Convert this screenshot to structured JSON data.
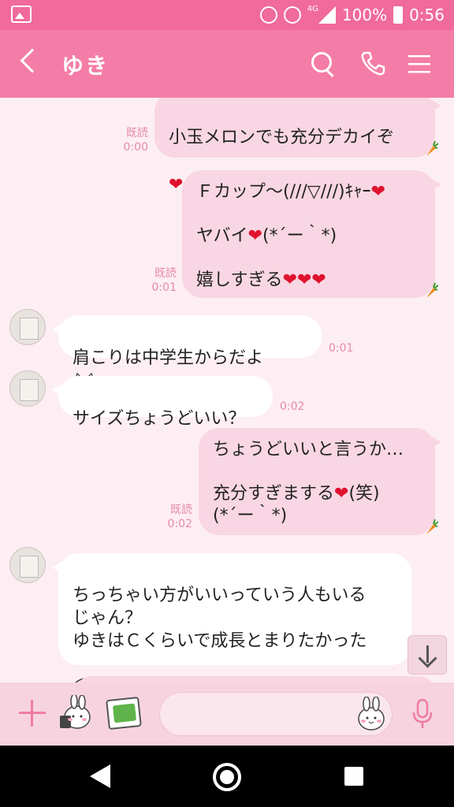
{
  "status_bar": {
    "network": "4G",
    "battery": "100%",
    "time": "0:56"
  },
  "header": {
    "title": "ゆき"
  },
  "messages": [
    {
      "id": 1,
      "dir": "out",
      "text": "小玉メロンでも充分デカイぞ",
      "hearts": "❤",
      "read": "既読",
      "time": "0:00"
    },
    {
      "id": 2,
      "dir": "out",
      "text_lines": [
        "Ｆカップ〜(///▽///)ｷｬｰ",
        "",
        "ヤバイ",
        "",
        "嬉しすぎる"
      ],
      "heart1": "❤",
      "heart2": "❤",
      "heart3": "❤❤❤",
      "kaomoji1": "(*´ー｀*)",
      "read": "既読",
      "time": "0:01"
    },
    {
      "id": 3,
      "dir": "in",
      "text": "肩こりは中学生からだよ",
      "time": "0:01"
    },
    {
      "id": 4,
      "dir": "in",
      "text": "サイズちょうどいい？",
      "time": "0:02"
    },
    {
      "id": 5,
      "dir": "out",
      "line1": "ちょうどいいと言うか…",
      "line2": "充分すぎまする",
      "heart": "❤",
      "line2b": "(笑)",
      "line3": "(*´ー｀*)",
      "read": "既読",
      "time": "0:02"
    },
    {
      "id": 6,
      "dir": "in",
      "text": "ちっちゃい方がいいっていう人もいる\nじゃん？\nゆきはＣくらいで成長とまりたかった"
    }
  ],
  "input": {
    "placeholder": ""
  },
  "colors": {
    "header": "#f47da7",
    "status_bar": "#f06a9b",
    "background": "#fdeef3",
    "out_bubble": "#f9d6e3",
    "in_bubble": "#ffffff",
    "read_label": "#e58aa9"
  },
  "icons": [
    "back-icon",
    "search-icon",
    "phone-icon",
    "menu-icon",
    "plus-icon",
    "sticker-icon",
    "photo-icon",
    "emoji-icon",
    "mic-icon",
    "scroll-down-icon"
  ]
}
